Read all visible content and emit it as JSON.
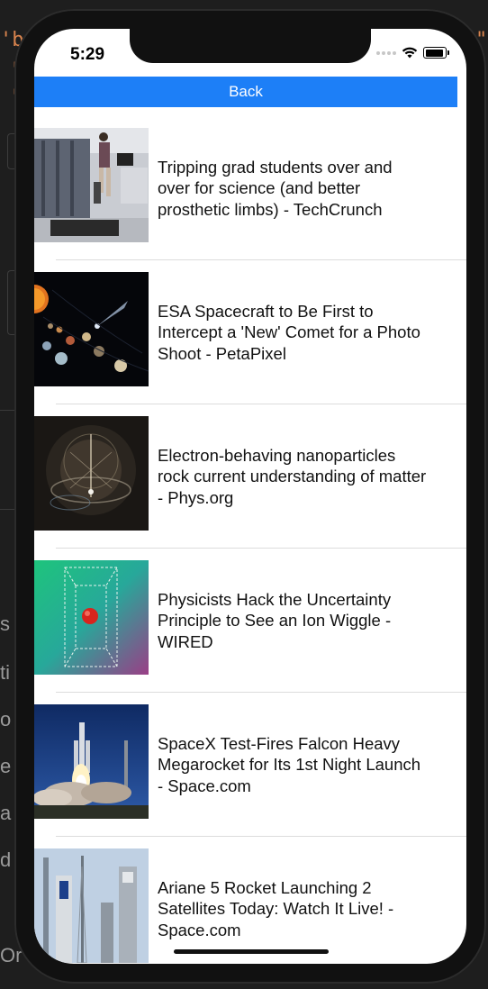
{
  "status_bar": {
    "time": "5:29"
  },
  "nav": {
    "back_label": "Back"
  },
  "articles": [
    {
      "title": "Tripping grad students over and over for science (and better prosthetic limbs) - TechCrunch",
      "thumb_icon": "lab-treadmill-photo"
    },
    {
      "title": "ESA Spacecraft to Be First to Intercept a 'New' Comet for a Photo Shoot - PetaPixel",
      "thumb_icon": "solar-system-photo"
    },
    {
      "title": "Electron-behaving nanoparticles rock current understanding of matter - Phys.org",
      "thumb_icon": "nanoparticle-photo"
    },
    {
      "title": "Physicists Hack the Uncertainty Principle to See an Ion Wiggle - WIRED",
      "thumb_icon": "ion-trap-illustration"
    },
    {
      "title": "SpaceX Test-Fires Falcon Heavy Megarocket for Its 1st Night Launch - Space.com",
      "thumb_icon": "rocket-launch-photo"
    },
    {
      "title": "Ariane 5 Rocket Launching 2 Satellites Today: Watch It Live! - Space.com",
      "thumb_icon": "launch-towers-photo"
    }
  ],
  "colors": {
    "accent": "#1d7ff7"
  }
}
